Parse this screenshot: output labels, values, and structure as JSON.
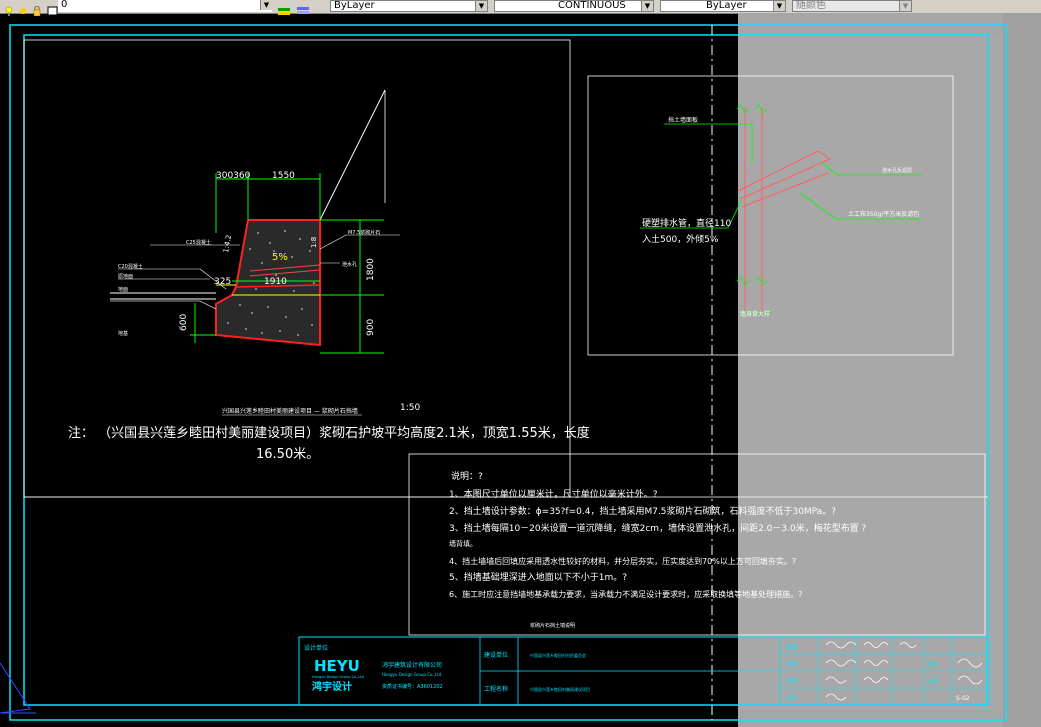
{
  "toolbar": {
    "layer_value": "0",
    "color_value": "ByLayer",
    "linetype_value": "CONTINUOUS",
    "lineweight_value": "ByLayer",
    "plotstyle_value": "随颜色"
  },
  "drawing": {
    "wall_section": {
      "dims": {
        "top_small": "300360",
        "top_width": "1550",
        "slope_left": "1:4.2",
        "slope_right": "1:8",
        "height_upper": "1800",
        "height_lower": "900",
        "base_width": "1910",
        "toe_width": "325",
        "footing_depth": "600",
        "gradient": "5%"
      },
      "labels": {
        "right_top": "M7.5浆砌片石",
        "right_mid": "泄水孔",
        "left_1": "C20混凝土",
        "left_2": "C25混凝土",
        "left_3": "原地面",
        "left_4": "地基",
        "ground": "地面"
      },
      "scale_title": "兴国县兴莲乡睦田村美丽建设项目 — 浆砌片石挡墙",
      "scale": "1:50"
    },
    "note_line1": "注： （兴国县兴莲乡睦田村美丽建设项目）浆砌石护坡平均高度2.1米，顶宽1.55米，长度",
    "note_line2": "16.50米。",
    "detail": {
      "label_top": "挡土墙面板",
      "label_left_1": "硬塑排水管，直径110",
      "label_left_2": "入土500，外倾5%",
      "label_right_1": "泄水孔反滤层",
      "label_right_2": "土工布350g/平方米反滤包",
      "label_bottom": "墙身背大样"
    },
    "specs": {
      "title": "说明：?",
      "items": [
        "1、本图尺寸单位以厘米计，尺寸单位以毫米计外。?",
        "2、挡土墙设计参数：ϕ=35?f=0.4，挡土墙采用M7.5浆砌片石砌筑，石料强度不低于30MPa。?",
        "3、挡土墙每隔10－20米设置一道沉降缝，缝宽2cm，墙体设置泄水孔，间距2.0－3.0米，梅花型布置   ?",
        "    墙背填。",
        "4、挡土墙墙后回填应采用透水性较好的材料，并分层夯实，压实度达到70%以上方可回填夯实。?",
        "5、挡墙基础埋深进入地面以下不小于1m。?",
        "6、施工时应注意挡墙地基承载力要求，当承载力不满足设计要求时，应采取换填等地基处理措施。?"
      ],
      "footer": "浆砌片石挡土墙说明"
    },
    "title_block": {
      "design_unit_label": "设计单位",
      "logo_text": "HEYU",
      "logo_sub": "Hongyu Design Group Co.,Ltd",
      "logo_cn": "鸿宇设计",
      "company_cn": "鸿宇建筑设计有限公司",
      "company_en": "Hongyu Design Group Co.,Ltd",
      "cert": "资质证书编号：A3601202",
      "construction_unit": "建设单位",
      "construction_value": "兴国县兴莲乡睦田村村民委员会",
      "project_name_label": "工程名称",
      "project_name_value": "兴国县兴莲乡睦田村美丽建设项目",
      "role_labels": [
        "审定",
        "审核",
        "校核",
        "设计"
      ],
      "drawing_no": "S-02",
      "sheet_label": "图号",
      "scale_label": "比例"
    }
  }
}
